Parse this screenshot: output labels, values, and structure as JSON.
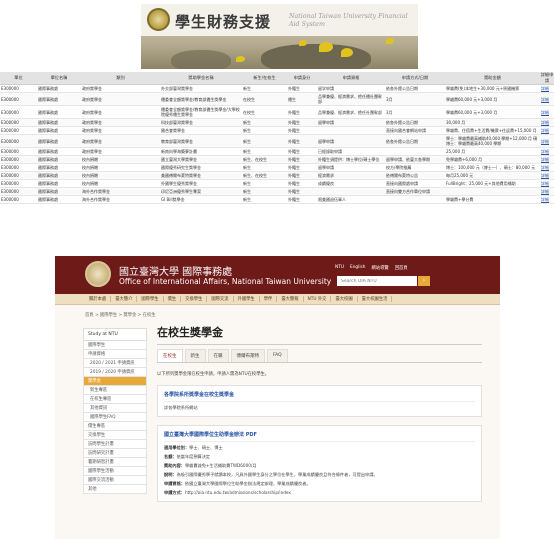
{
  "financial_aid": {
    "title_cn": "學生財務支援",
    "title_en": "National Taiwan University Financial Aid System",
    "columns": [
      "單位",
      "單位名稱",
      "類別",
      "獎助學金名稱",
      "新生/在校生",
      "申請身分",
      "申請資格",
      "申請方式/日期",
      "獎助金額",
      "詳細申請"
    ],
    "rows": [
      [
        "E300000",
        "國際事務處",
        "政府獎學金",
        "外交部臺灣獎學金",
        "新生",
        "外籍生",
        "留学申請",
        "依各外館公告日期",
        "學雜費(免)本地生+30,000 元+原國機票",
        "詳細"
      ],
      [
        "E300000",
        "國際事務處",
        "政府獎學金",
        "僑委會全額獎學金/教育部僑生獎學金",
        "在校生",
        "僑生",
        "品學兼優、經濟需求、擔任僑社團幹部",
        "3月",
        "學雜費60,000 元+3,000 月",
        "詳細"
      ],
      [
        "E300000",
        "國際事務處",
        "政府獎學金",
        "僑委會全額獎學金/教育部僑生獎學金/大學校院優秀僑生獎學金",
        "在校生",
        "外籍生",
        "品學兼優、經濟需求、擔任社團幹部",
        "3月",
        "學雜費60,000 元+3,000 月",
        "詳細"
      ],
      [
        "E300000",
        "國際事務處",
        "政府獎學金",
        "科技部臺灣獎學金",
        "新生",
        "外籍生",
        "留學申請",
        "依各外館公告日期",
        "30,000 月",
        "詳細"
      ],
      [
        "E300000",
        "國際事務處",
        "政府獎學金",
        "國合會獎學金",
        "新生",
        "外籍生",
        "",
        "直接向國合會網站申請",
        "學雜費、住宿費+生活費/機票+往返費+15,000 月",
        "詳細"
      ],
      [
        "E300000",
        "國際事務處",
        "政府獎學金",
        "教育部臺灣獎學金",
        "新生",
        "外籍生",
        "留學申請",
        "依各外館公告日期",
        "學士：學雜費最高補助40,000 學期+12,000 月 碩博士：學雜費最高40,000 學期",
        "詳細"
      ],
      [
        "E300000",
        "國際事務處",
        "政府獎學金",
        "新南向學海築夢計畫",
        "新生",
        "外籍生",
        "已經錄取申請",
        "",
        "25,000 月",
        "詳細"
      ],
      [
        "E300000",
        "國際事務處",
        "校內捐贈",
        "國立臺灣大學獎學金",
        "新生、在校生",
        "外籍生",
        "外籍生須提供：博士學位/碩士學位",
        "留學申請、依臺大各學期",
        "免學雜費+6,000 月",
        "詳細"
      ],
      [
        "E300000",
        "國際事務處",
        "校內捐贈",
        "國際優秀研究生獎學金",
        "新生",
        "外籍生",
        "留學申請",
        "校方/學院推薦",
        "博士：100,000 元（博士一）、碩士：80,000 元",
        "詳細"
      ],
      [
        "E300000",
        "國際事務處",
        "校內捐贈",
        "美國傅爾布萊特獎學金",
        "新生、在校生",
        "外籍生",
        "經濟需求",
        "依傅爾布萊特公告",
        "每月25,000 元",
        "詳細"
      ],
      [
        "E300000",
        "國際事務處",
        "校內捐贈",
        "外國學生優秀獎學金",
        "新生",
        "外籍生",
        "成績優良",
        "直接向國際處申請",
        "FullBright：25,000 元+其他費用補助",
        "詳細"
      ],
      [
        "E300000",
        "國際事務處",
        "海外合作獎學金",
        "印尼亞洲優秀學生專案",
        "新生",
        "外籍生",
        "",
        "直接向雙方合作單位申請",
        "",
        "詳細"
      ],
      [
        "E300000",
        "國際事務處",
        "海外合作獎學金",
        "GI Bill獎學金",
        "新生",
        "外籍生",
        "限美國退伍軍人",
        "",
        "學雜費+學分費",
        "詳細"
      ]
    ]
  },
  "oia": {
    "title_cn": "國立臺灣大學 國際事務處",
    "title_en": "Office of International Affairs, National Taiwan University",
    "top_links": [
      "NTU",
      "English",
      "網站導覽",
      "回首頁"
    ],
    "search_placeholder": "Search OIA NTU",
    "nav": [
      "關於本處",
      "臺大簡介",
      "國際學生",
      "僑生",
      "交換學生",
      "國際交流",
      "外國學生",
      "學伴",
      "臺大簡報",
      "NTU 外交",
      "臺大校園",
      "臺大校園生活"
    ],
    "breadcrumb": "首頁 > 國際學生 > 獎學金 > 在校生",
    "sidebar": {
      "group_title": "Study at NTU",
      "items": [
        "國際學生",
        "申請資格",
        "2020 / 2021 申請資訊",
        "2019 / 2020 申請資訊",
        "獎學金",
        "新生專區",
        "在校生專區",
        "其他資訊",
        "國際學生FAQ",
        "僑生專區",
        "交換學生",
        "訪問學生計畫",
        "訪問研究計畫",
        "暑期研習計畫",
        "國際學生活動",
        "國際交流活動",
        "其他"
      ]
    },
    "page_title": "在校生獎學金",
    "tabs": [
      "在校生",
      "新生",
      "在職",
      "傅爾布萊特",
      "FAQ"
    ],
    "note": "以下所列獎學金限在校生申請，申請人需為NTU在校學生。",
    "cards": [
      {
        "title": "各學院系所獎學金在校生獎學金",
        "body": "詳各學院系所網站"
      },
      {
        "title": "國立臺灣大學國際學位生助學金辦法 PDF",
        "lines": [
          [
            "適用學位別：",
            "學士、碩士、博士"
          ],
          [
            "名額：",
            "依當年度預算決定"
          ],
          [
            "獎助內容：",
            "學雜費減免+生活補助費TWD6000/月"
          ],
          [
            "說明：",
            "為吸引國際優秀學子就讀本校，凡具外國學生身分之學位在學生，學業成績優良且符合條件者，可提出申請。"
          ],
          [
            "申請資格：",
            "依國立臺灣大學國際學位生助學金辦法規定辦理，學業成績優良者。"
          ],
          [
            "申請方式：",
            "http://oia.ntu.edu.tw/admissions/scholarship/index"
          ]
        ]
      }
    ]
  }
}
